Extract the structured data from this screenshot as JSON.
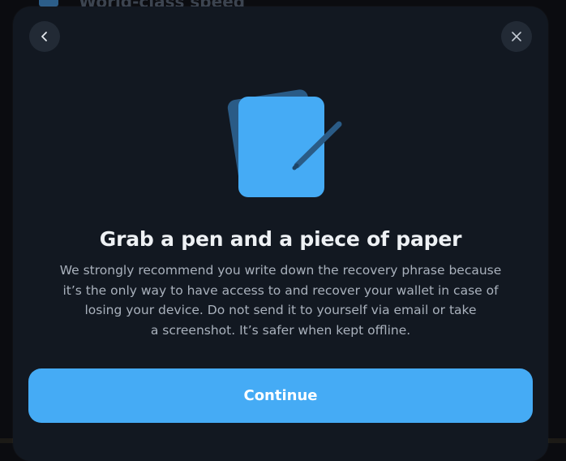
{
  "background": {
    "partial_heading": "World-class speed"
  },
  "modal": {
    "back_icon": "chevron-left-icon",
    "close_icon": "close-icon",
    "illustration_icon": "paper-and-pen-icon",
    "title": "Grab a pen and a piece of paper",
    "description_lines": [
      "We strongly recommend you write down the recovery phrase because",
      "it’s the only way to have access to and recover your wallet in case of",
      "losing your device. Do not send it to yourself via email or take",
      "a screenshot. It’s safer when kept offline."
    ],
    "continue_label": "Continue"
  },
  "colors": {
    "modal_bg": "#121821",
    "accent": "#45abf5",
    "accent_dark": "#2c5e8a",
    "title": "#eef1f4",
    "text_muted": "#a9b1bc"
  }
}
